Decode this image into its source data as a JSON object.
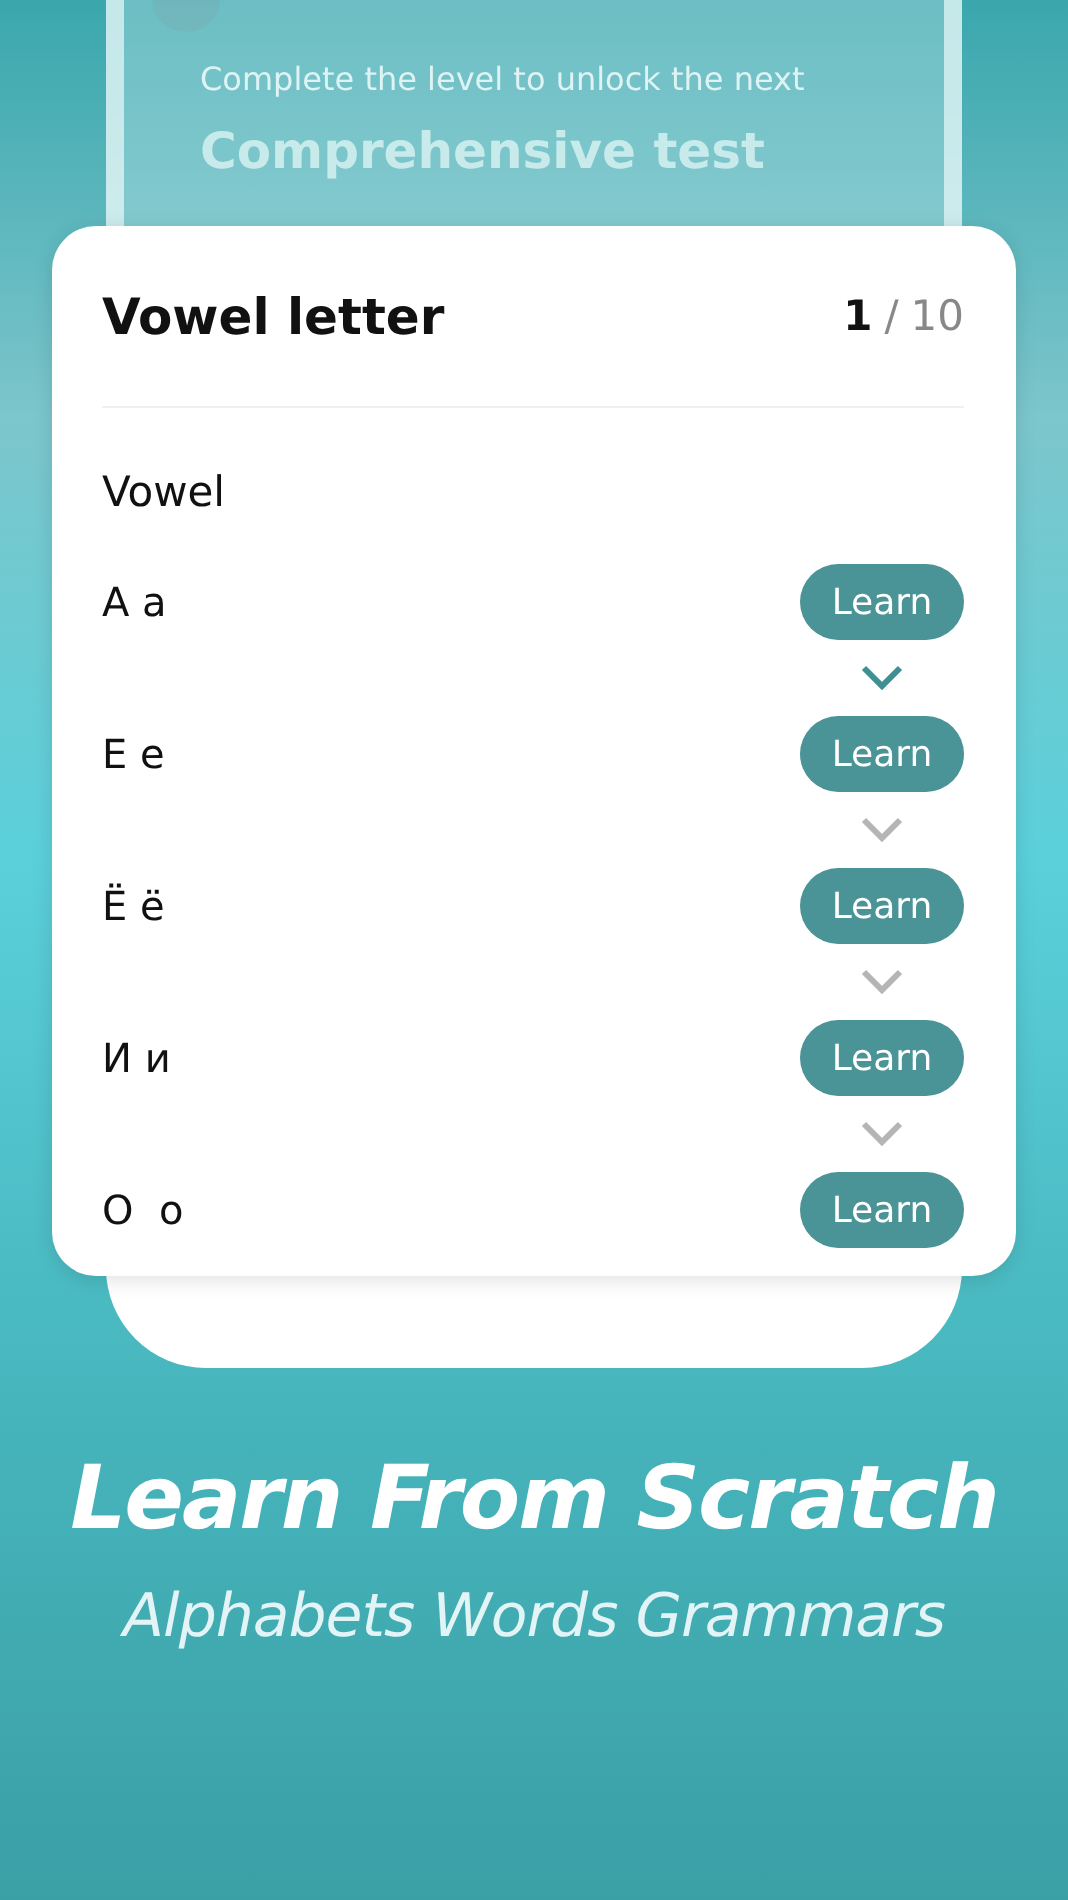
{
  "locked_level": {
    "hint": "Complete the level to unlock the next",
    "title": "Comprehensive test"
  },
  "lesson": {
    "title": "Vowel letter",
    "progress": {
      "current": "1",
      "separator": "/",
      "total": "10"
    },
    "section": "Vowel",
    "letters": [
      {
        "letter": "А а",
        "button": "Learn",
        "next_unlocked": true
      },
      {
        "letter": "Е е",
        "button": "Learn",
        "next_unlocked": false
      },
      {
        "letter": "Ё ё",
        "button": "Learn",
        "next_unlocked": false
      },
      {
        "letter": "И и",
        "button": "Learn",
        "next_unlocked": false
      },
      {
        "letter": "О  о",
        "button": "Learn"
      }
    ]
  },
  "caption": {
    "headline": "Learn From Scratch",
    "subtitle": "Alphabets Words Grammars"
  }
}
